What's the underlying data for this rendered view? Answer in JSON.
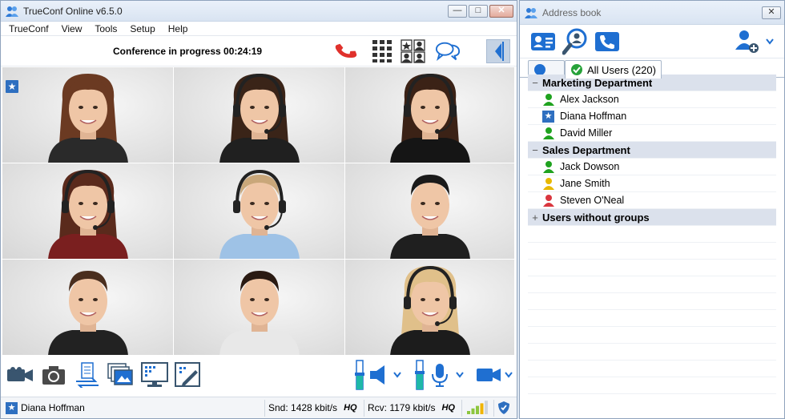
{
  "main": {
    "title": "TrueConf Online v6.5.0",
    "window_buttons": {
      "minimize": "—",
      "maximize": "□",
      "close": "✕"
    },
    "menu": [
      "TrueConf",
      "View",
      "Tools",
      "Setup",
      "Help"
    ],
    "conference_status": "Conference in progress 00:24:19",
    "toolbar_icons": [
      "hangup-icon",
      "dialpad-icon",
      "layout-icon",
      "chat-icon",
      "collapse-panel-icon"
    ],
    "participants": [
      {
        "name": "p1",
        "gender": "f",
        "hair": "#6b3a22",
        "headset": false,
        "shirt": "#2a2a2a"
      },
      {
        "name": "p2",
        "gender": "f",
        "hair": "#3a2418",
        "headset": true,
        "shirt": "#202020"
      },
      {
        "name": "p3",
        "gender": "f",
        "hair": "#3b2216",
        "headset": true,
        "shirt": "#151515"
      },
      {
        "name": "p4",
        "gender": "f",
        "hair": "#5a2a1c",
        "headset": true,
        "shirt": "#7a1f1f"
      },
      {
        "name": "p5",
        "gender": "m",
        "hair": "#c9a77a",
        "headset": true,
        "shirt": "#9ec2e6"
      },
      {
        "name": "p6",
        "gender": "m",
        "hair": "#1a1a1a",
        "headset": false,
        "shirt": "#1f1f1f"
      },
      {
        "name": "p7",
        "gender": "m",
        "hair": "#4a2e1e",
        "headset": false,
        "shirt": "#222"
      },
      {
        "name": "p8",
        "gender": "m",
        "hair": "#2a1a12",
        "headset": false,
        "shirt": "#e8e8e8"
      },
      {
        "name": "p9",
        "gender": "f",
        "hair": "#e0c08a",
        "headset": true,
        "shirt": "#1c1c1c"
      }
    ],
    "status": {
      "user": "Diana Hoffman",
      "snd": "Snd: 1428 kbit/s",
      "snd_quality": "HQ",
      "rcv": "Rcv: 1179 kbit/s",
      "rcv_quality": "HQ",
      "signal_level": 0.8
    },
    "colors": {
      "accent": "#1f6fd1",
      "hangup": "#e0312c"
    }
  },
  "addressbook": {
    "title": "Address book",
    "window_buttons": {
      "close": "✕"
    },
    "tabs": [
      {
        "label": ""
      },
      {
        "label": "All Users (220)"
      }
    ],
    "groups": [
      {
        "name": "Marketing Department",
        "expanded": true,
        "toggle": "−",
        "users": [
          {
            "name": "Alex Jackson",
            "status": "online",
            "color": "#1fa21f"
          },
          {
            "name": "Diana Hoffman",
            "status": "self",
            "color": "#2e6fc0"
          },
          {
            "name": "David Miller",
            "status": "online",
            "color": "#1fa21f"
          }
        ]
      },
      {
        "name": "Sales Department",
        "expanded": true,
        "toggle": "−",
        "users": [
          {
            "name": "Jack Dowson",
            "status": "online",
            "color": "#1fa21f"
          },
          {
            "name": "Jane Smith",
            "status": "busy",
            "color": "#e8b800"
          },
          {
            "name": "Steven O'Neal",
            "status": "in-conference",
            "color": "#d9363e"
          }
        ]
      },
      {
        "name": "Users without groups",
        "expanded": false,
        "toggle": "+",
        "users": []
      }
    ]
  }
}
